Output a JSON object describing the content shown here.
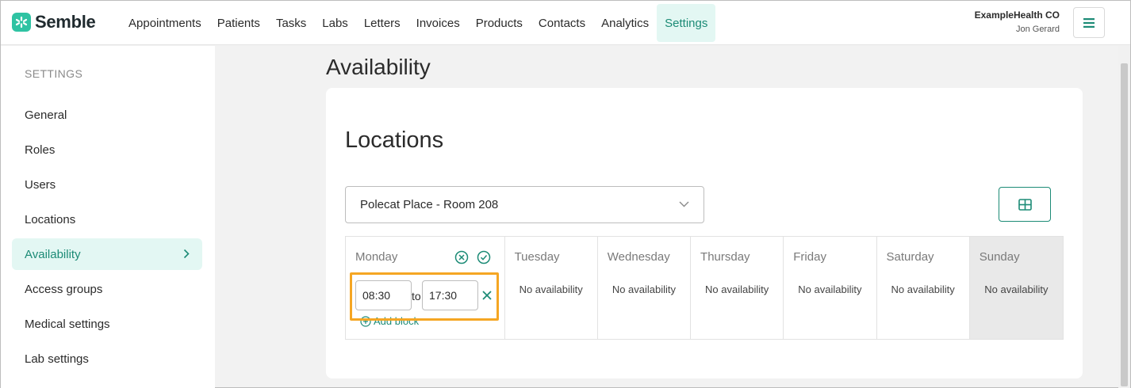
{
  "brand": {
    "name": "Semble",
    "accent": "#1c8b76",
    "logo_color": "#2fc3a3",
    "highlight": "#f5a623"
  },
  "nav": {
    "items": [
      {
        "label": "Appointments"
      },
      {
        "label": "Patients"
      },
      {
        "label": "Tasks"
      },
      {
        "label": "Labs"
      },
      {
        "label": "Letters"
      },
      {
        "label": "Invoices"
      },
      {
        "label": "Products"
      },
      {
        "label": "Contacts"
      },
      {
        "label": "Analytics"
      },
      {
        "label": "Settings",
        "active": true
      }
    ]
  },
  "account": {
    "org": "ExampleHealth CO",
    "user": "Jon Gerard",
    "menu_icon": "hamburger-icon"
  },
  "sidebar": {
    "heading": "SETTINGS",
    "items": [
      {
        "label": "General"
      },
      {
        "label": "Roles"
      },
      {
        "label": "Users"
      },
      {
        "label": "Locations"
      },
      {
        "label": "Availability",
        "active": true,
        "icon": "chevron-right-icon"
      },
      {
        "label": "Access groups"
      },
      {
        "label": "Medical settings"
      },
      {
        "label": "Lab settings"
      }
    ]
  },
  "page": {
    "title": "Availability"
  },
  "locations": {
    "title": "Locations",
    "selected_location": "Polecat Place - Room 208",
    "select_icon": "chevron-down-icon",
    "view_toggle_icon": "grid-icon"
  },
  "schedule": {
    "days": [
      {
        "name": "Monday",
        "icons": [
          "circle-x-icon",
          "circle-check-icon"
        ],
        "block": {
          "start": "08:30",
          "separator": "to",
          "end": "17:30",
          "remove_icon": "close-icon"
        },
        "add_block_label": "Add block"
      },
      {
        "name": "Tuesday",
        "status": "No availability"
      },
      {
        "name": "Wednesday",
        "status": "No availability"
      },
      {
        "name": "Thursday",
        "status": "No availability"
      },
      {
        "name": "Friday",
        "status": "No availability"
      },
      {
        "name": "Saturday",
        "status": "No availability"
      },
      {
        "name": "Sunday",
        "status": "No availability"
      }
    ]
  }
}
